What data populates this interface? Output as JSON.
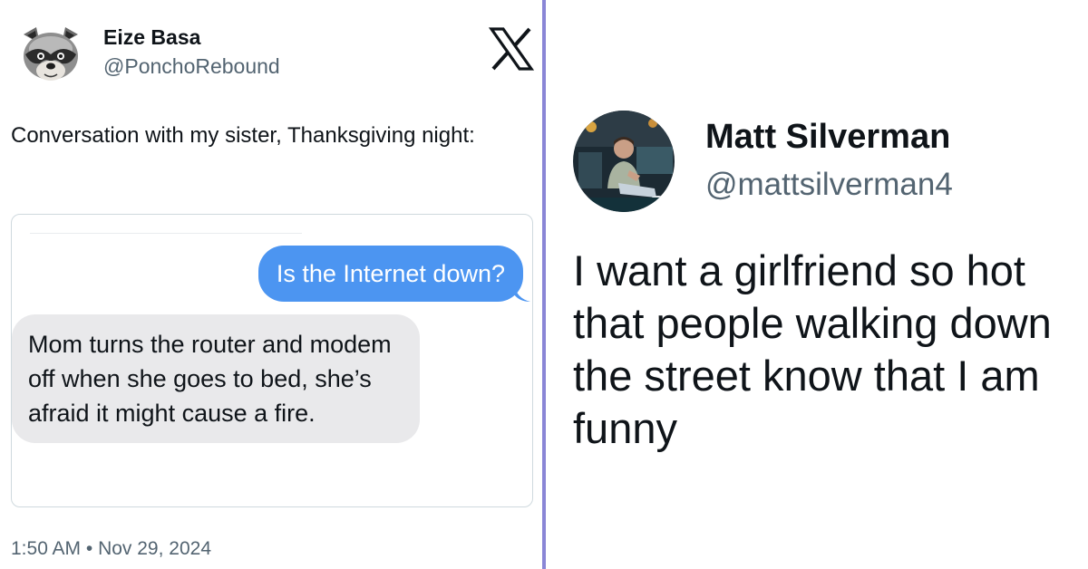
{
  "left_tweet": {
    "author_name": "Eize Basa",
    "handle": "@PonchoRebound",
    "avatar": "raccoon-avatar",
    "platform_icon": "x-logo-icon",
    "text": "Conversation with my sister, Thanksgiving night:",
    "messages": {
      "sent": "Is the Internet down?",
      "received": "Mom turns the router and modem off when she goes to bed, she’s afraid it might cause a fire."
    },
    "timestamp": "1:50 AM • Nov 29, 2024"
  },
  "right_tweet": {
    "author_name": "Matt Silverman",
    "handle": "@mattsilverman4",
    "avatar": "person-photo-avatar",
    "text": "I want a girlfriend so hot that people walking down the street know that I am funny"
  },
  "colors": {
    "divider": "#8a86d6",
    "sent_bubble": "#4c95f1",
    "received_bubble": "#e9e9eb",
    "secondary_text": "#536471"
  }
}
